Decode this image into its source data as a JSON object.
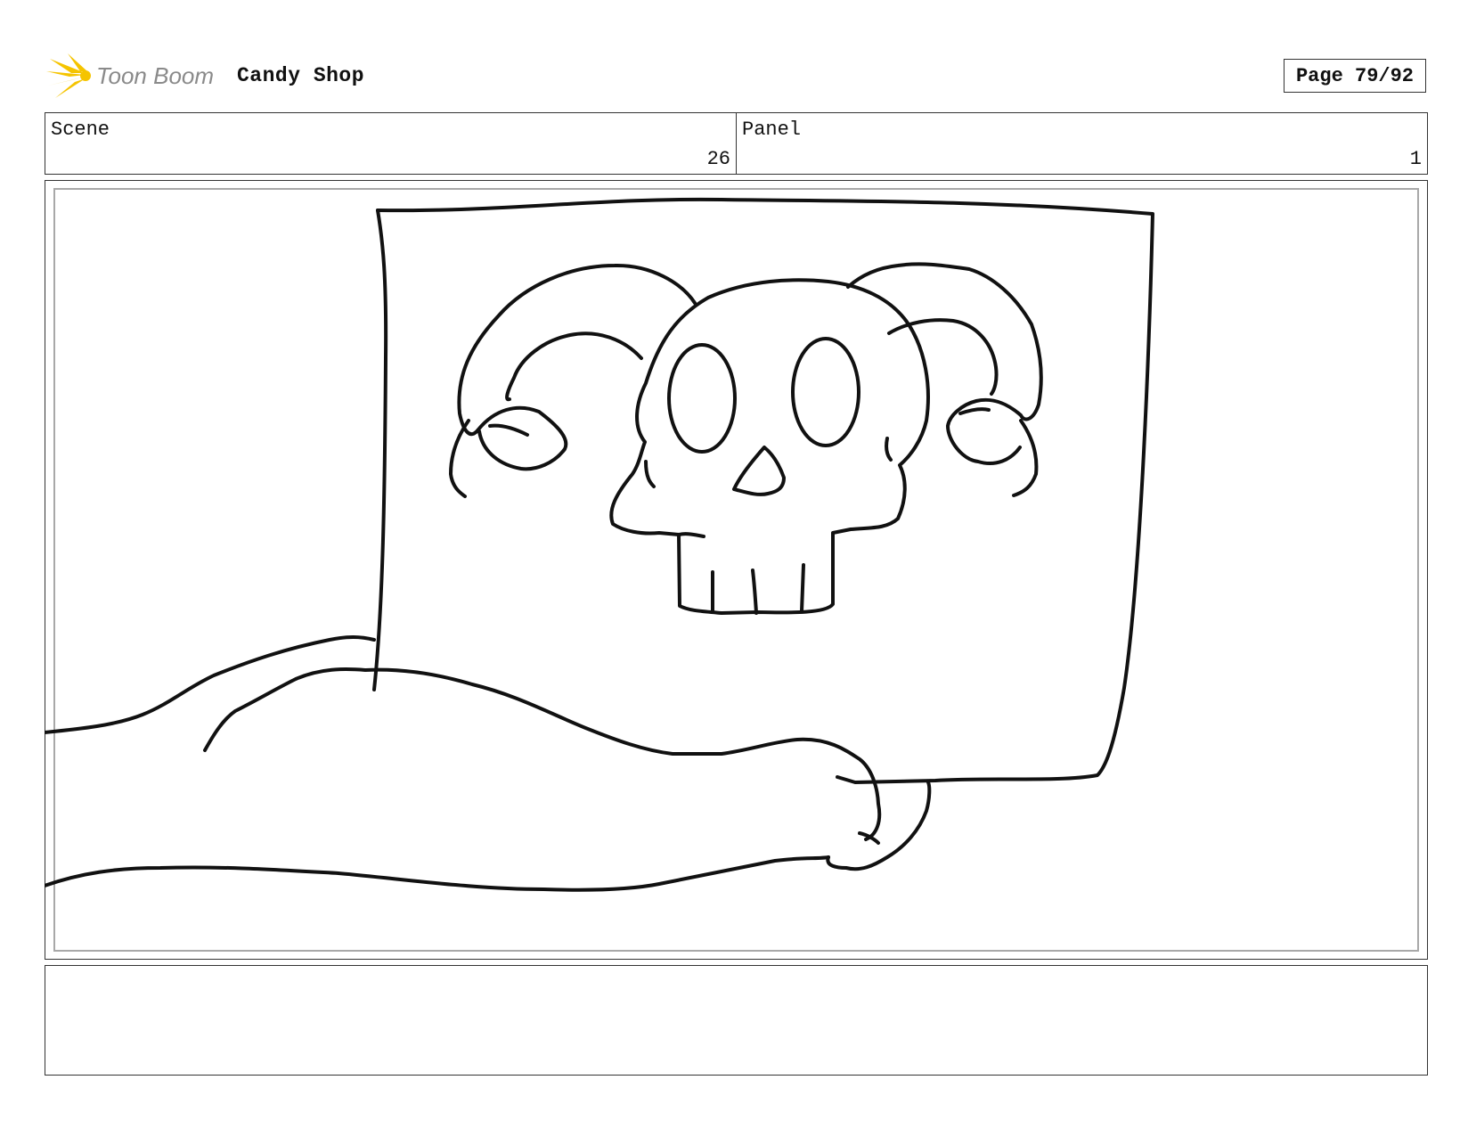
{
  "header": {
    "logo_text": "Toon Boom",
    "project_title": "Candy Shop",
    "page_label": "Page 79/92"
  },
  "scene": {
    "label": "Scene",
    "value": "26"
  },
  "panel": {
    "label": "Panel",
    "value": "1"
  },
  "colors": {
    "logo_star": "#f5c400",
    "logo_text": "#8a8a8a",
    "line": "#111111"
  },
  "notes": ""
}
